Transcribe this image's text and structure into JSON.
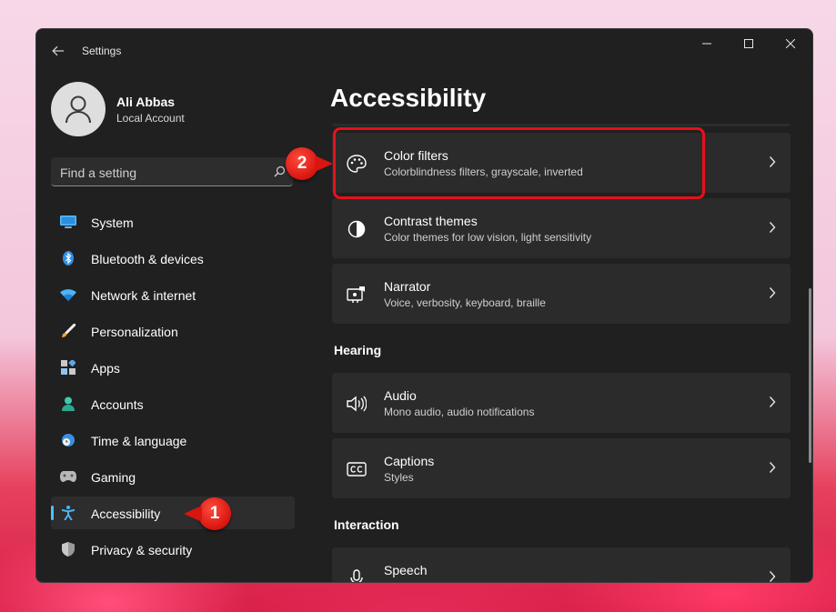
{
  "window": {
    "title": "Settings",
    "controls": {
      "minimize": "minimize-icon",
      "maximize": "maximize-icon",
      "close": "close-icon"
    }
  },
  "profile": {
    "name": "Ali Abbas",
    "account_type": "Local Account"
  },
  "search": {
    "placeholder": "Find a setting"
  },
  "sidebar": {
    "items": [
      {
        "label": "System",
        "icon": "monitor-icon"
      },
      {
        "label": "Bluetooth & devices",
        "icon": "bluetooth-icon"
      },
      {
        "label": "Network & internet",
        "icon": "wifi-icon"
      },
      {
        "label": "Personalization",
        "icon": "brush-icon"
      },
      {
        "label": "Apps",
        "icon": "apps-icon"
      },
      {
        "label": "Accounts",
        "icon": "person-icon"
      },
      {
        "label": "Time & language",
        "icon": "globe-clock-icon"
      },
      {
        "label": "Gaming",
        "icon": "gamepad-icon"
      },
      {
        "label": "Accessibility",
        "icon": "accessibility-icon",
        "selected": true
      },
      {
        "label": "Privacy & security",
        "icon": "shield-icon"
      }
    ]
  },
  "main": {
    "title": "Accessibility",
    "cards": [
      {
        "title": "Color filters",
        "subtitle": "Colorblindness filters, grayscale, inverted",
        "icon": "palette-icon"
      },
      {
        "title": "Contrast themes",
        "subtitle": "Color themes for low vision, light sensitivity",
        "icon": "contrast-icon"
      },
      {
        "title": "Narrator",
        "subtitle": "Voice, verbosity, keyboard, braille",
        "icon": "narrator-icon"
      }
    ],
    "sections": [
      {
        "label": "Hearing",
        "cards": [
          {
            "title": "Audio",
            "subtitle": "Mono audio, audio notifications",
            "icon": "speaker-icon"
          },
          {
            "title": "Captions",
            "subtitle": "Styles",
            "icon": "captions-icon"
          }
        ]
      },
      {
        "label": "Interaction",
        "cards": [
          {
            "title": "Speech",
            "icon": "microphone-icon"
          }
        ]
      }
    ]
  },
  "annotations": {
    "step1": "1",
    "step2": "2",
    "color": "#e8101c"
  },
  "colors": {
    "accent": "#4cc2ff",
    "window_bg": "#202020",
    "card_bg": "#2b2b2b"
  }
}
